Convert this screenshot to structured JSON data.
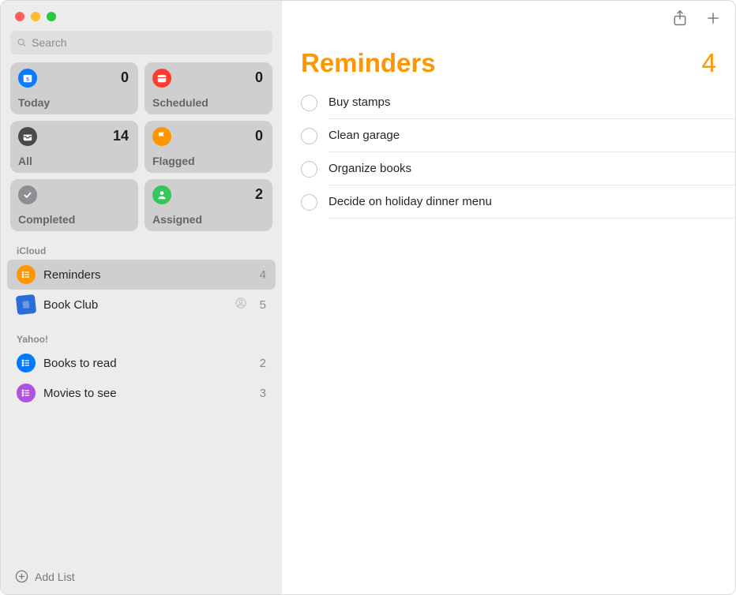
{
  "search": {
    "placeholder": "Search",
    "value": ""
  },
  "smartLists": {
    "today": {
      "label": "Today",
      "count": "0"
    },
    "scheduled": {
      "label": "Scheduled",
      "count": "0"
    },
    "all": {
      "label": "All",
      "count": "14"
    },
    "flagged": {
      "label": "Flagged",
      "count": "0"
    },
    "completed": {
      "label": "Completed",
      "count": ""
    },
    "assigned": {
      "label": "Assigned",
      "count": "2"
    }
  },
  "sections": {
    "icloud": {
      "title": "iCloud",
      "lists": [
        {
          "label": "Reminders",
          "count": "4",
          "shared": false
        },
        {
          "label": "Book Club",
          "count": "5",
          "shared": true
        }
      ]
    },
    "yahoo": {
      "title": "Yahoo!",
      "lists": [
        {
          "label": "Books to read",
          "count": "2"
        },
        {
          "label": "Movies to see",
          "count": "3"
        }
      ]
    }
  },
  "footer": {
    "addList": "Add List"
  },
  "main": {
    "title": "Reminders",
    "count": "4",
    "items": [
      "Buy stamps",
      "Clean garage",
      "Organize books",
      "Decide on holiday dinner menu"
    ]
  }
}
